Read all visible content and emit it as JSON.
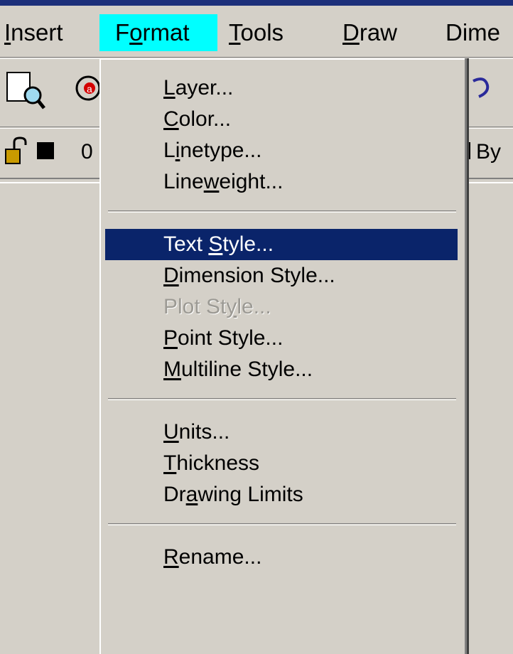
{
  "menubar": {
    "items": [
      {
        "label": "Insert",
        "mnemonic": "I",
        "active": false
      },
      {
        "label": "Format",
        "mnemonic": "o",
        "active": true
      },
      {
        "label": "Tools",
        "mnemonic": "T",
        "active": false
      },
      {
        "label": "Draw",
        "mnemonic": "D",
        "active": false
      },
      {
        "label": "Dime",
        "mnemonic": "",
        "active": false
      }
    ]
  },
  "toolbar": {
    "layer_value": "0",
    "bylayer_value": "By"
  },
  "format_menu": {
    "groups": [
      [
        {
          "label": "Layer...",
          "mnemonic_index": 0,
          "state": "normal"
        },
        {
          "label": "Color...",
          "mnemonic_index": 0,
          "state": "normal"
        },
        {
          "label": "Linetype...",
          "mnemonic_index": 1,
          "state": "normal"
        },
        {
          "label": "Lineweight...",
          "mnemonic_index": 4,
          "state": "normal"
        }
      ],
      [
        {
          "label": "Text Style...",
          "mnemonic_index": 5,
          "state": "highlighted"
        },
        {
          "label": "Dimension Style...",
          "mnemonic_index": 0,
          "state": "normal"
        },
        {
          "label": "Plot Style...",
          "mnemonic_index": 7,
          "state": "disabled"
        },
        {
          "label": "Point Style...",
          "mnemonic_index": 0,
          "state": "normal"
        },
        {
          "label": "Multiline Style...",
          "mnemonic_index": 0,
          "state": "normal"
        }
      ],
      [
        {
          "label": "Units...",
          "mnemonic_index": 0,
          "state": "normal"
        },
        {
          "label": "Thickness",
          "mnemonic_index": 0,
          "state": "normal"
        },
        {
          "label": "Drawing Limits",
          "mnemonic_index": 2,
          "state": "normal"
        }
      ],
      [
        {
          "label": "Rename...",
          "mnemonic_index": 0,
          "state": "normal"
        }
      ]
    ]
  },
  "colors": {
    "menu_bg": "#d4d0c8",
    "active_menu_bg": "#00ffff",
    "highlight_bg": "#0a246a",
    "highlight_fg": "#ffffff",
    "disabled_fg": "#9c9a94",
    "title_bar": "#1c2f7a"
  }
}
